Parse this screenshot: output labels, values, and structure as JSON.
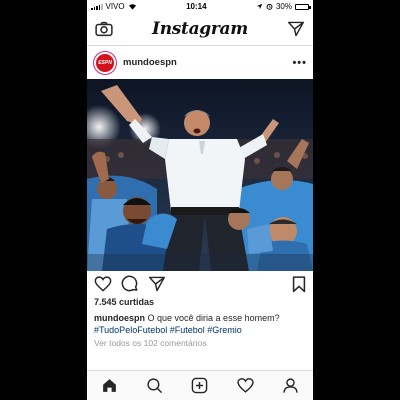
{
  "status_bar": {
    "carrier": "VIVO",
    "time": "10:14",
    "battery": "30%",
    "battery_level": 0.3
  },
  "app": {
    "logo": "Instagram",
    "camera_icon": "camera-icon",
    "direct_icon": "paper-plane-icon"
  },
  "post": {
    "username": "mundoespn",
    "avatar_text": "ESPN",
    "more_icon": "ellipsis-icon",
    "more_label": "•••",
    "image_alt": "Coach being lifted by players celebrating in stadium",
    "likes": "7.545 curtidas",
    "caption_user": "mundoespn",
    "caption_text": "O que você diria a esse homem?",
    "hashtags": [
      "#TudoPeloFutebol",
      "#Futebol",
      "#Gremio"
    ],
    "comments_link": "Ver todos os 102 comentários"
  },
  "colors": {
    "espn_red": "#d3111e",
    "hashtag_blue": "#003569",
    "jersey_blue": "#3b8bd0"
  },
  "tabbar": {
    "items": [
      "home-icon",
      "search-icon",
      "add-post-icon",
      "heart-icon",
      "profile-icon"
    ]
  }
}
